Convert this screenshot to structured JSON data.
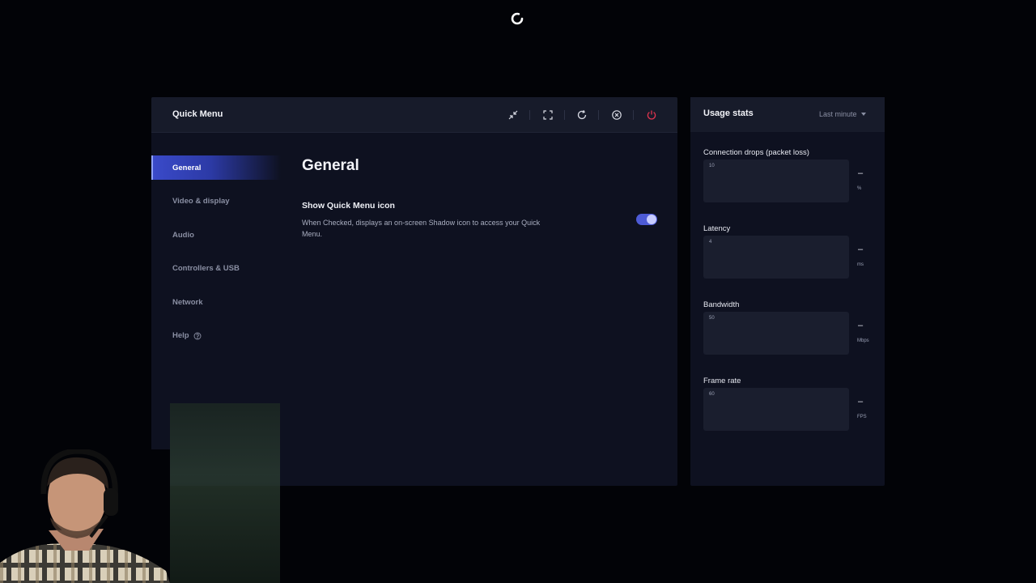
{
  "quick_menu": {
    "title": "Quick Menu",
    "header_icons": [
      "collapse-icon",
      "fullscreen-icon",
      "refresh-icon",
      "close-circle-icon",
      "power-icon"
    ],
    "sidebar": [
      {
        "label": "General",
        "active": true
      },
      {
        "label": "Video & display",
        "active": false
      },
      {
        "label": "Audio",
        "active": false
      },
      {
        "label": "Controllers & USB",
        "active": false
      },
      {
        "label": "Network",
        "active": false
      },
      {
        "label": "Help",
        "active": false
      }
    ],
    "content": {
      "heading": "General",
      "option_title": "Show Quick Menu icon",
      "option_desc": "When Checked, displays an on-screen Shadow icon to access your Quick Menu.",
      "toggle_on": true
    }
  },
  "usage_stats": {
    "title": "Usage stats",
    "range": "Last minute",
    "stats": [
      {
        "label": "Connection drops (packet loss)",
        "max": "10",
        "value": "–",
        "unit": "%"
      },
      {
        "label": "Latency",
        "max": "4",
        "value": "–",
        "unit": "ms"
      },
      {
        "label": "Bandwidth",
        "max": "50",
        "value": "–",
        "unit": "Mbps"
      },
      {
        "label": "Frame rate",
        "max": "60",
        "value": "–",
        "unit": "FPS"
      }
    ]
  },
  "colors": {
    "accent": "#4d5bd6",
    "power": "#e0344f",
    "panel": "#0e1120",
    "header": "#171b2a"
  }
}
